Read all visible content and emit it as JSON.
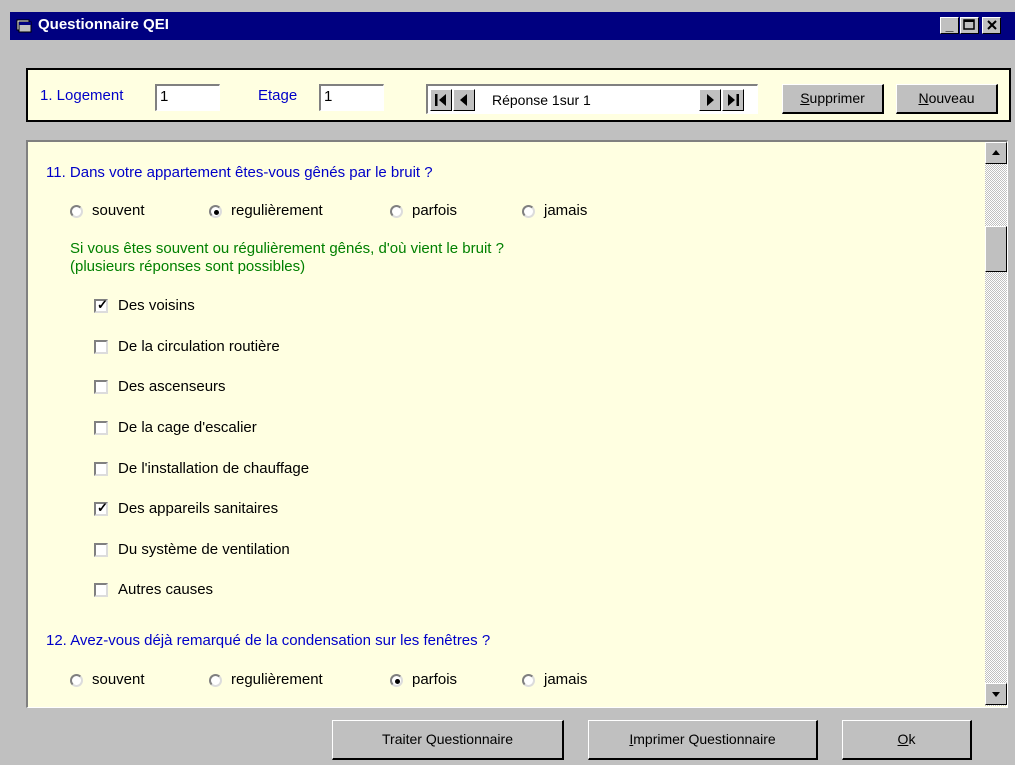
{
  "window": {
    "title": "Questionnaire QEI",
    "min_glyph": "_",
    "max_glyph": "□",
    "close_glyph": "✕"
  },
  "header": {
    "logement_label": "1. Logement",
    "logement_value": "1",
    "etage_label": "Etage",
    "etage_value": "1",
    "record_label": "Réponse 1sur 1",
    "supprimer_first": "S",
    "supprimer_rest": "upprimer",
    "nouveau_first": "N",
    "nouveau_rest": "ouveau"
  },
  "q11": {
    "title": "11. Dans votre appartement êtes-vous gênés par le bruit ?",
    "options": [
      "souvent",
      "regulièrement",
      "parfois",
      "jamais"
    ],
    "selected": 1,
    "followup_line1": "Si vous êtes souvent ou régulièrement gênés, d'où vient le bruit ?",
    "followup_line2": "(plusieurs réponses sont possibles)",
    "sources": [
      {
        "label": "Des voisins",
        "checked": true
      },
      {
        "label": "De la circulation routière",
        "checked": false
      },
      {
        "label": "Des ascenseurs",
        "checked": false
      },
      {
        "label": "De la cage d'escalier",
        "checked": false
      },
      {
        "label": "De l'installation de chauffage",
        "checked": false
      },
      {
        "label": "Des appareils sanitaires",
        "checked": true
      },
      {
        "label": "Du système de ventilation",
        "checked": false
      },
      {
        "label": "Autres causes",
        "checked": false
      }
    ]
  },
  "q12": {
    "title": "12. Avez-vous déjà remarqué de la condensation sur les fenêtres ?",
    "options": [
      "souvent",
      "regulièrement",
      "parfois",
      "jamais"
    ],
    "selected": 2
  },
  "footer": {
    "traiter": "Traiter Questionnaire",
    "imprimer_first": "I",
    "imprimer_rest": "mprimer Questionnaire",
    "ok_first": "O",
    "ok_rest": "k"
  }
}
